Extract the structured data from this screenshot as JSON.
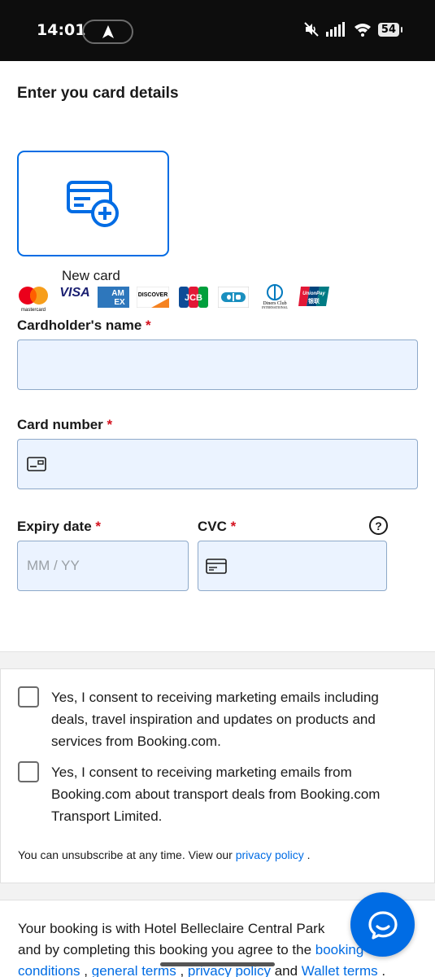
{
  "status_bar": {
    "time": "14:01",
    "battery": "54"
  },
  "page": {
    "title": "Enter you card details"
  },
  "card_options": {
    "new_card_label": "New card"
  },
  "card_logos": {
    "mastercard": "mastercard",
    "visa": "VISA",
    "amex_top": "AM",
    "amex_bottom": "EX",
    "discover": "DISCOVER",
    "jcb": "JCB",
    "diners_top": "Diners Club",
    "diners_bottom": "INTERNATIONAL",
    "unionpay": "UnionPay",
    "unionpay_cn": "银联"
  },
  "form": {
    "cardholder_label": "Cardholder's name",
    "card_number_label": "Card number",
    "expiry_label": "Expiry date",
    "expiry_placeholder": "MM / YY",
    "cvc_label": "CVC",
    "required_mark": "*",
    "help_symbol": "?"
  },
  "consent": {
    "marketing_booking": "Yes, I consent to receiving marketing emails including deals, travel inspiration and updates on products and services from Booking.com.",
    "marketing_transport": "Yes, I consent to receiving marketing emails from Booking.com about transport deals from Booking.com Transport Limited.",
    "unsubscribe_text": "You can unsubscribe at any time. View our",
    "privacy_link": "privacy policy",
    "unsubscribe_end": "."
  },
  "terms": {
    "intro": "Your booking is with Hotel Belleclaire Central Park",
    "middle": "and by completing this booking you agree to the",
    "booking_conditions_link_1": "booking",
    "booking_conditions_link_2": "conditions",
    "sep1": ",",
    "general_terms_link": "general terms",
    "sep2": ",",
    "privacy_policy_link": "privacy policy",
    "and_word": "and",
    "wallet_terms_link": "Wallet terms",
    "end": "."
  },
  "colors": {
    "accent": "#006ce4",
    "required": "#d4111e",
    "input_bg": "#ebf3ff"
  }
}
